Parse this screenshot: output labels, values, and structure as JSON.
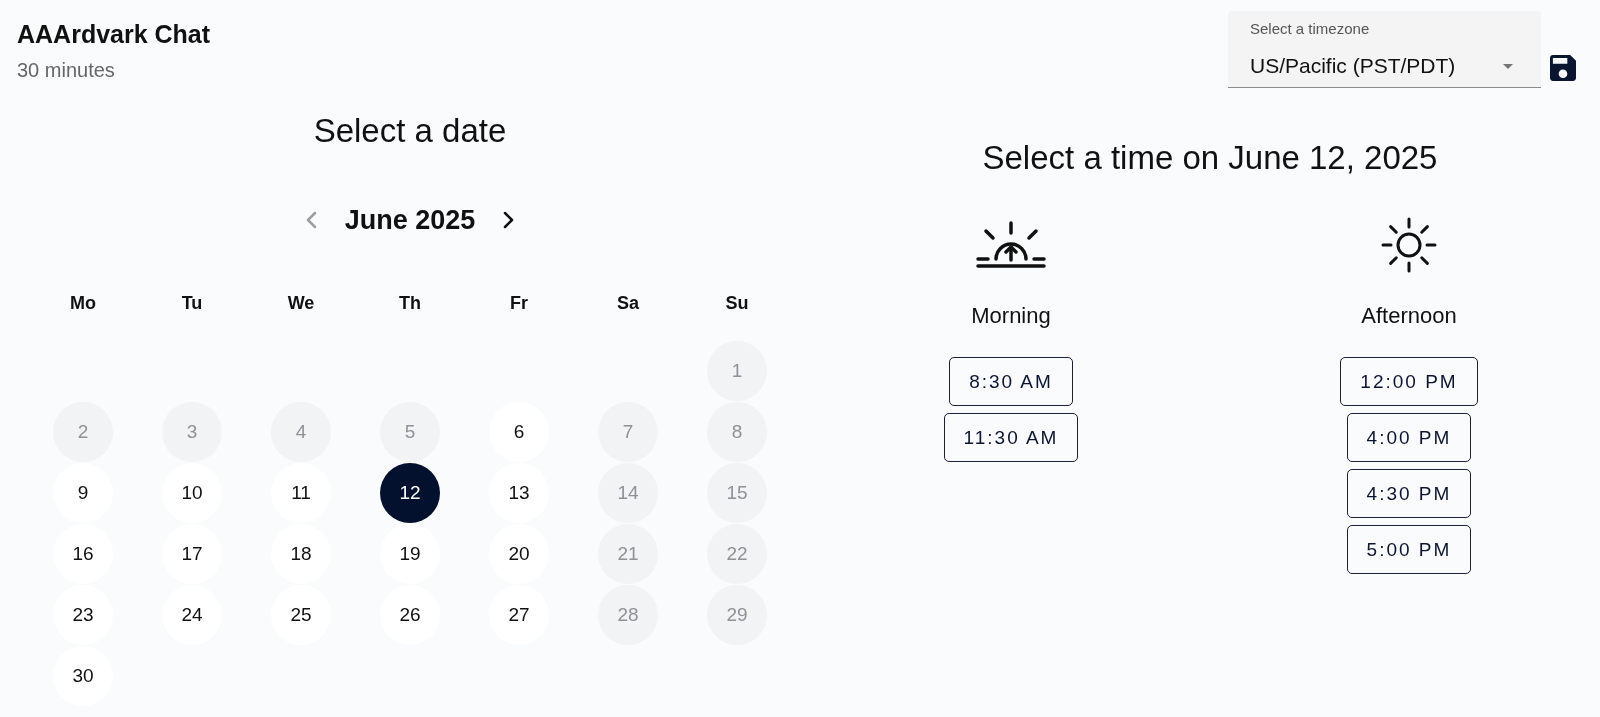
{
  "header": {
    "title": "AAArdvark Chat",
    "subtitle": "30 minutes"
  },
  "timezone": {
    "label": "Select a timezone",
    "value": "US/Pacific (PST/PDT)"
  },
  "date_picker": {
    "title": "Select a date",
    "month": "June 2025",
    "previous": {
      "disabled": true
    },
    "next": {
      "disabled": false
    },
    "weekdays": [
      "Mo",
      "Tu",
      "We",
      "Th",
      "Fr",
      "Sa",
      "Su"
    ],
    "weeks": [
      [
        {
          "day": "1",
          "disabled": true,
          "selected": false
        }
      ],
      [
        {
          "day": "2",
          "disabled": true,
          "selected": false
        },
        {
          "day": "3",
          "disabled": true,
          "selected": false
        },
        {
          "day": "4",
          "disabled": true,
          "selected": false
        },
        {
          "day": "5",
          "disabled": true,
          "selected": false
        },
        {
          "day": "6",
          "disabled": false,
          "selected": false
        },
        {
          "day": "7",
          "disabled": true,
          "selected": false
        },
        {
          "day": "8",
          "disabled": true,
          "selected": false
        }
      ],
      [
        {
          "day": "9",
          "disabled": false,
          "selected": false
        },
        {
          "day": "10",
          "disabled": false,
          "selected": false
        },
        {
          "day": "11",
          "disabled": false,
          "selected": false
        },
        {
          "day": "12",
          "disabled": false,
          "selected": true
        },
        {
          "day": "13",
          "disabled": false,
          "selected": false
        },
        {
          "day": "14",
          "disabled": true,
          "selected": false
        },
        {
          "day": "15",
          "disabled": true,
          "selected": false
        }
      ],
      [
        {
          "day": "16",
          "disabled": false,
          "selected": false
        },
        {
          "day": "17",
          "disabled": false,
          "selected": false
        },
        {
          "day": "18",
          "disabled": false,
          "selected": false
        },
        {
          "day": "19",
          "disabled": false,
          "selected": false
        },
        {
          "day": "20",
          "disabled": false,
          "selected": false
        },
        {
          "day": "21",
          "disabled": true,
          "selected": false
        },
        {
          "day": "22",
          "disabled": true,
          "selected": false
        }
      ],
      [
        {
          "day": "23",
          "disabled": false,
          "selected": false
        },
        {
          "day": "24",
          "disabled": false,
          "selected": false
        },
        {
          "day": "25",
          "disabled": false,
          "selected": false
        },
        {
          "day": "26",
          "disabled": false,
          "selected": false
        },
        {
          "day": "27",
          "disabled": false,
          "selected": false
        },
        {
          "day": "28",
          "disabled": true,
          "selected": false
        },
        {
          "day": "29",
          "disabled": true,
          "selected": false
        }
      ],
      [
        {
          "day": "30",
          "disabled": false,
          "selected": false
        }
      ]
    ]
  },
  "time_picker": {
    "title": "Select a time on June 12, 2025",
    "periods": [
      {
        "kind": "morning",
        "label": "Morning",
        "slots": [
          "8:30 AM",
          "11:30 AM"
        ]
      },
      {
        "kind": "afternoon",
        "label": "Afternoon",
        "slots": [
          "12:00 PM",
          "4:00 PM",
          "4:30 PM",
          "5:00 PM"
        ]
      }
    ]
  }
}
